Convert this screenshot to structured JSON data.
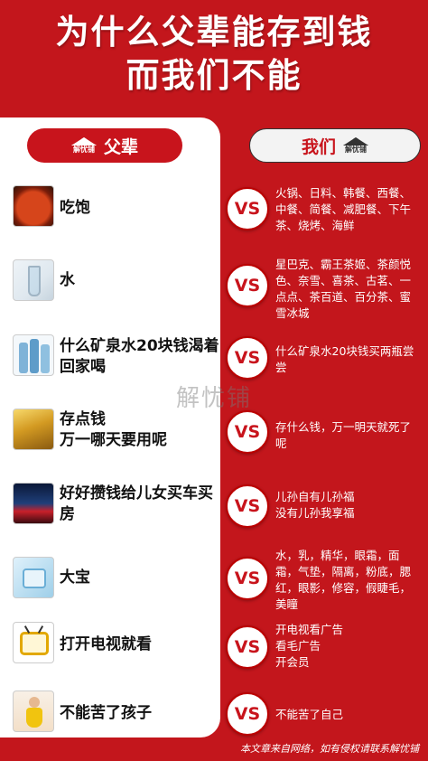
{
  "title": {
    "line1": "为什么父辈能存到钱",
    "line2": "而我们不能"
  },
  "header": {
    "left_label": "父辈",
    "right_label": "我们",
    "logo_text": "解忧铺"
  },
  "vs_label": "VS",
  "rows": [
    {
      "left": "吃饱",
      "right": "火锅、日料、韩餐、西餐、中餐、简餐、减肥餐、下午茶、烧烤、海鲜",
      "thumb": "food-photo"
    },
    {
      "left": "水",
      "right": "星巴克、霸王茶姬、茶颜悦色、奈雪、喜茶、古茗、一点点、茶百道、百分茶、蜜雪冰城",
      "thumb": "water-photo"
    },
    {
      "left": "什么矿泉水20块钱渴着回家喝",
      "right": "什么矿泉水20块钱买两瓶尝尝",
      "thumb": "bottles-photo"
    },
    {
      "left": "存点钱\n万一哪天要用呢",
      "right": "存什么钱，万一明天就死了呢",
      "thumb": "gold-photo"
    },
    {
      "left": "好好攒钱给儿女买车买房",
      "right": "儿孙自有儿孙福\n没有儿孙我享福",
      "thumb": "car-photo"
    },
    {
      "left": "大宝",
      "right": "水，乳，精华，眼霜，面霜，气垫，隔离，粉底，腮红，眼影，修容，假睫毛，美瞳",
      "thumb": "cream-photo"
    },
    {
      "left": "打开电视就看",
      "right": "开电视看广告\n看毛广告\n开会员",
      "thumb": "tv-photo"
    },
    {
      "left": "不能苦了孩子",
      "right": "不能苦了自己",
      "thumb": "child-photo"
    }
  ],
  "watermark": "解忧铺",
  "footer": "本文章来自网络，如有侵权请联系解忧铺"
}
